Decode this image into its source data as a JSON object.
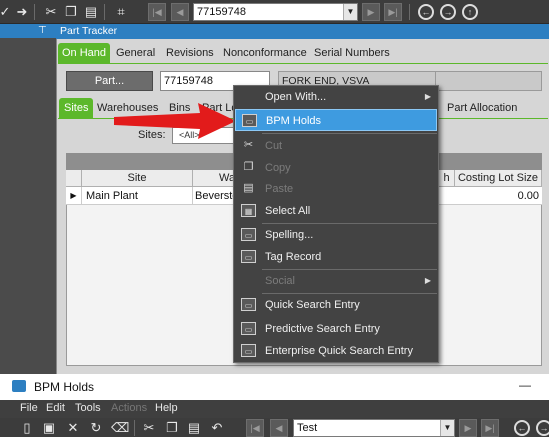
{
  "toolbar": {
    "part_value": "77159748"
  },
  "dock": {
    "pin_glyph": "⊤"
  },
  "part_tracker": {
    "title": "Part Tracker",
    "tabs": [
      "On Hand",
      "General",
      "Revisions",
      "Nonconformance",
      "Serial Numbers"
    ],
    "active_tab": "On Hand",
    "part_button": "Part...",
    "part_number": "77159748",
    "part_description": "FORK END, VSVA",
    "subtabs": [
      "Sites",
      "Warehouses",
      "Bins",
      "Part Lo",
      "Part Allocation"
    ],
    "active_subtab": "Sites",
    "sites_label": "Sites:",
    "sites_value": "<All>",
    "grid": {
      "columns": [
        "Site",
        "Wa",
        "h",
        "Costing Lot Size"
      ],
      "rows": [
        {
          "site": "Main Plant",
          "warehouse": "Beverston",
          "lot_size": "0.00"
        }
      ]
    }
  },
  "context_menu": {
    "items": [
      {
        "label": "Open With...",
        "enabled": true,
        "submenu": true,
        "icon": "none"
      },
      {
        "label": "BPM Holds",
        "enabled": true,
        "highlighted": true,
        "icon": "bpm-icon"
      },
      {
        "label": "Cut",
        "enabled": false,
        "icon": "scissors-icon"
      },
      {
        "label": "Copy",
        "enabled": false,
        "icon": "copy-icon"
      },
      {
        "label": "Paste",
        "enabled": false,
        "icon": "paste-icon"
      },
      {
        "label": "Select All",
        "enabled": true,
        "icon": "select-all-icon"
      },
      {
        "label": "Spelling...",
        "enabled": true,
        "icon": "spelling-icon"
      },
      {
        "label": "Tag Record",
        "enabled": true,
        "icon": "tag-icon"
      },
      {
        "label": "Social",
        "enabled": false,
        "submenu": true,
        "icon": "none"
      },
      {
        "label": "Quick Search Entry",
        "enabled": true,
        "icon": "quick-search-icon"
      },
      {
        "label": "Predictive Search Entry",
        "enabled": true,
        "icon": "predictive-search-icon"
      },
      {
        "label": "Enterprise Quick Search Entry",
        "enabled": true,
        "icon": "enterprise-search-icon"
      }
    ]
  },
  "bpm_window": {
    "title": "BPM Holds",
    "menu": [
      "File",
      "Edit",
      "Tools",
      "Actions",
      "Help"
    ],
    "disabled_menu": [
      "Actions"
    ],
    "combo_value": "Test",
    "minimize_glyph": "—"
  },
  "colors": {
    "accent": "#2d7fc1",
    "tab_active": "#5cb82b",
    "menu_highlight": "#3e9be0",
    "arrow": "#e21b1b"
  }
}
